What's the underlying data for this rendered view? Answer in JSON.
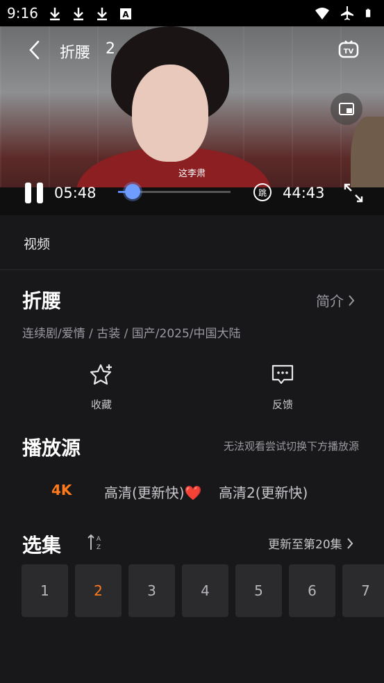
{
  "status_bar": {
    "time": "9:16",
    "left_icons": [
      "download-icon",
      "download-icon",
      "download-icon",
      "font-a-icon"
    ],
    "right_icons": [
      "wifi-icon",
      "airplane-icon",
      "battery-icon"
    ]
  },
  "player": {
    "title": "折腰",
    "episode": "2",
    "subtitle": "这李肃",
    "time_current": "05:48",
    "time_total": "44:43",
    "progress": 0.13,
    "skip_label": "跳",
    "accent": "#5d8df7"
  },
  "tabs": {
    "video": "视频"
  },
  "show": {
    "title": "折腰",
    "intro_label": "简介",
    "meta": "连续剧/爱情 / 古装 / 国产/2025/中国大陆"
  },
  "actions": [
    {
      "label": "收藏",
      "icon": "star-plus-icon"
    },
    {
      "label": "反馈",
      "icon": "message-icon"
    }
  ],
  "sources": {
    "title": "播放源",
    "hint": "无法观看尝试切换下方播放源",
    "items": [
      {
        "label": "4K",
        "active": true
      },
      {
        "label": "高清(更新快)",
        "suffix": "❤️",
        "active": false
      },
      {
        "label": "高清2(更新快)",
        "active": false
      }
    ],
    "active_color": "#ff7a1a"
  },
  "episodes": {
    "title": "选集",
    "update_label": "更新至第20集",
    "items": [
      "1",
      "2",
      "3",
      "4",
      "5",
      "6",
      "7"
    ],
    "active": "2"
  }
}
